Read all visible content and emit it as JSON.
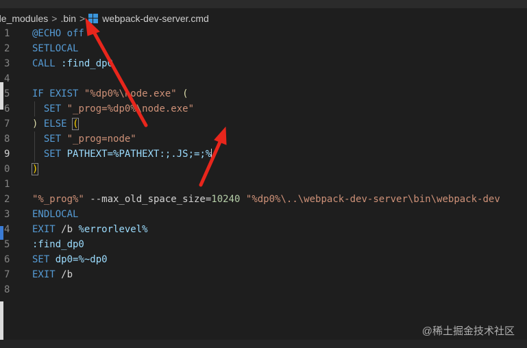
{
  "breadcrumb": {
    "seg1": "de_modules",
    "seg2": ".bin",
    "seg3": "webpack-dev-server.cmd",
    "sep": ">"
  },
  "lines": [
    {
      "n": "1",
      "tokens": [
        [
          "kw",
          "@ECHO off"
        ]
      ]
    },
    {
      "n": "2",
      "tokens": [
        [
          "kw",
          "SETLOCAL"
        ]
      ]
    },
    {
      "n": "3",
      "tokens": [
        [
          "kw",
          "CALL"
        ],
        [
          "punc",
          " "
        ],
        [
          "var",
          ":find_dp0"
        ]
      ]
    },
    {
      "n": "4",
      "tokens": []
    },
    {
      "n": "5",
      "tokens": [
        [
          "kw",
          "IF EXIST"
        ],
        [
          "punc",
          " "
        ],
        [
          "str",
          "\"%dp0%\\node.exe\""
        ],
        [
          "punc",
          " "
        ],
        [
          "fn",
          "("
        ]
      ]
    },
    {
      "n": "6",
      "tokens": [
        [
          "punc",
          "  "
        ],
        [
          "kw",
          "SET"
        ],
        [
          "punc",
          " "
        ],
        [
          "str",
          "\"_prog=%dp0%\\node.exe\""
        ]
      ]
    },
    {
      "n": "7",
      "tokens": [
        [
          "fn",
          ")"
        ],
        [
          "punc",
          " "
        ],
        [
          "kw",
          "ELSE"
        ],
        [
          "punc",
          " "
        ],
        [
          "brk",
          "("
        ]
      ]
    },
    {
      "n": "8",
      "tokens": [
        [
          "punc",
          "  "
        ],
        [
          "kw",
          "SET"
        ],
        [
          "punc",
          " "
        ],
        [
          "str",
          "\"_prog=node\""
        ]
      ]
    },
    {
      "n": "9",
      "tokens": [
        [
          "punc",
          "  "
        ],
        [
          "kw",
          "SET"
        ],
        [
          "punc",
          " "
        ],
        [
          "var",
          "PATHEXT=%PATHEXT:;.JS;=;%"
        ]
      ]
    },
    {
      "n": "0",
      "tokens": [
        [
          "brk",
          ")"
        ]
      ]
    },
    {
      "n": "1",
      "tokens": []
    },
    {
      "n": "2",
      "tokens": [
        [
          "str",
          "\"%_prog%\""
        ],
        [
          "punc",
          " --max_old_space_size="
        ],
        [
          "num",
          "10240"
        ],
        [
          "punc",
          " "
        ],
        [
          "str",
          "\"%dp0%\\..\\webpack-dev-server\\bin\\webpack-dev"
        ]
      ]
    },
    {
      "n": "3",
      "tokens": [
        [
          "kw",
          "ENDLOCAL"
        ]
      ]
    },
    {
      "n": "4",
      "tokens": [
        [
          "kw",
          "EXIT"
        ],
        [
          "punc",
          " /b "
        ],
        [
          "var",
          "%errorlevel%"
        ]
      ]
    },
    {
      "n": "5",
      "tokens": [
        [
          "var",
          ":find_dp0"
        ]
      ]
    },
    {
      "n": "6",
      "tokens": [
        [
          "kw",
          "SET"
        ],
        [
          "punc",
          " "
        ],
        [
          "var",
          "dp0=%~dp0"
        ]
      ]
    },
    {
      "n": "7",
      "tokens": [
        [
          "kw",
          "EXIT"
        ],
        [
          "punc",
          " /b"
        ]
      ]
    },
    {
      "n": "8",
      "tokens": []
    }
  ],
  "watermark": "@稀土掘金技术社区",
  "colors": {
    "background": "#1e1e1e",
    "keyword": "#569cd6",
    "string": "#ce9178",
    "number": "#b5cea8",
    "variable": "#9cdcfe",
    "arrow": "#e8261c"
  },
  "icons": {
    "file_icon": "windows-icon"
  }
}
